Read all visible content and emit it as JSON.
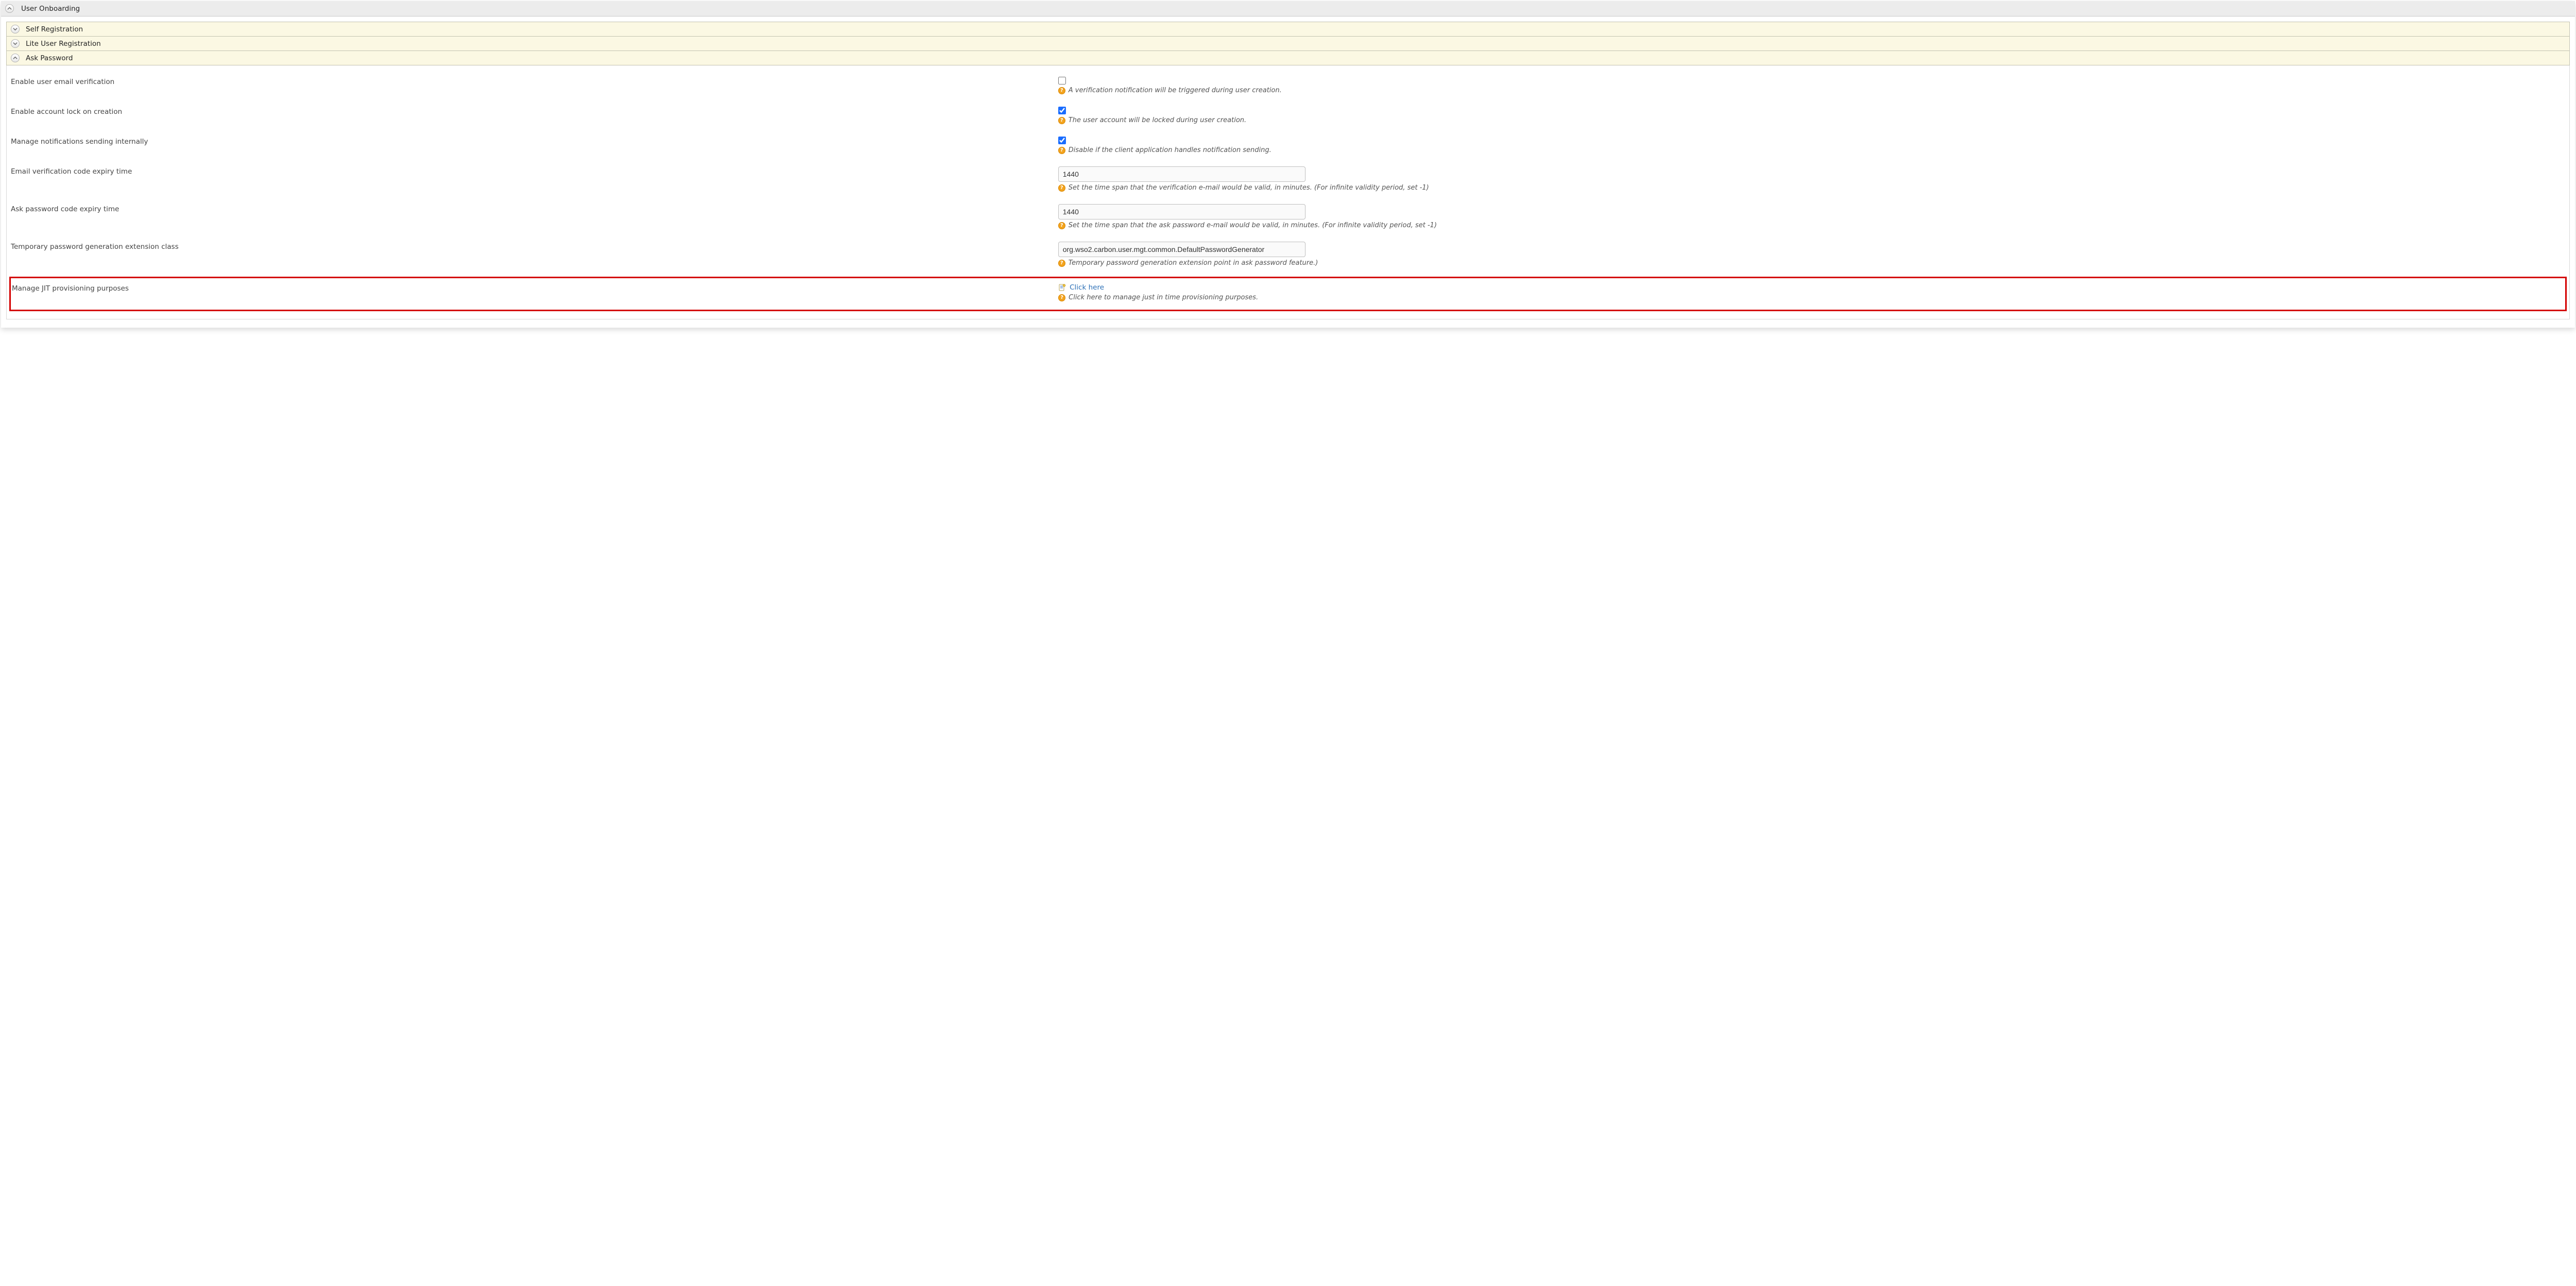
{
  "panel": {
    "title": "User Onboarding"
  },
  "sections": {
    "self_registration": {
      "title": "Self Registration"
    },
    "lite_user_registration": {
      "title": "Lite User Registration"
    },
    "ask_password": {
      "title": "Ask Password"
    }
  },
  "fields": {
    "email_verification": {
      "label": "Enable user email verification",
      "checked": false,
      "hint": "A verification notification will be triggered during user creation."
    },
    "account_lock": {
      "label": "Enable account lock on creation",
      "checked": true,
      "hint": "The user account will be locked during user creation."
    },
    "manage_notifications": {
      "label": "Manage notifications sending internally",
      "checked": true,
      "hint": "Disable if the client application handles notification sending."
    },
    "email_expiry": {
      "label": "Email verification code expiry time",
      "value": "1440",
      "hint": "Set the time span that the verification e-mail would be valid, in minutes. (For infinite validity period, set -1)"
    },
    "ask_expiry": {
      "label": "Ask password code expiry time",
      "value": "1440",
      "hint": "Set the time span that the ask password e-mail would be valid, in minutes. (For infinite validity period, set -1)"
    },
    "temp_password_class": {
      "label": "Temporary password generation extension class",
      "value": "org.wso2.carbon.user.mgt.common.DefaultPasswordGenerator",
      "hint": "Temporary password generation extension point in ask password feature.)"
    },
    "jit": {
      "label": "Manage JIT provisioning purposes",
      "link_text": "Click here",
      "hint": "Click here to manage just in time provisioning purposes."
    }
  }
}
